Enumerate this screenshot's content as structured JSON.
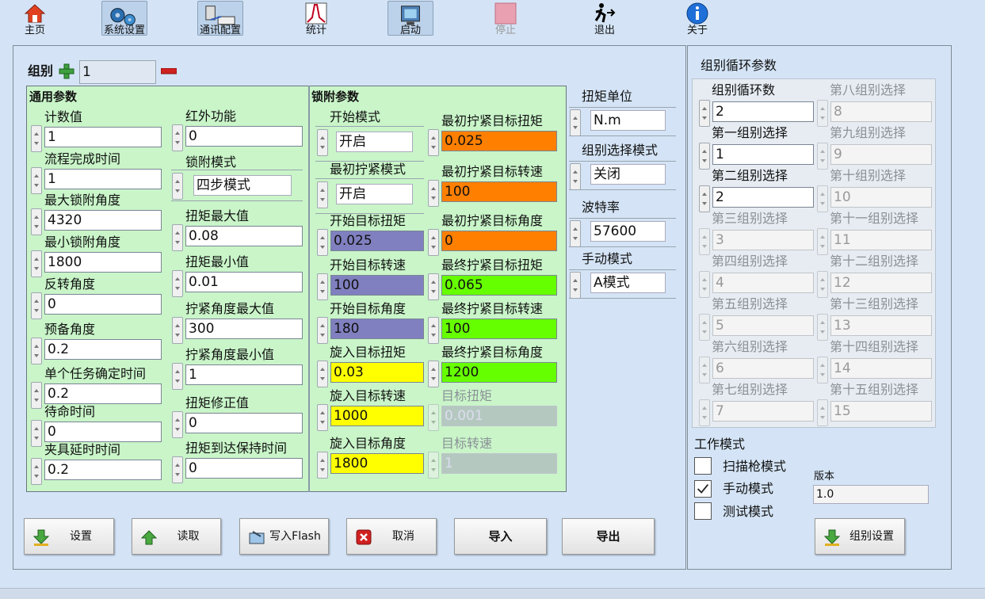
{
  "toolbar": {
    "home": "主页",
    "system_settings": "系统设置",
    "comm_config": "通讯配置",
    "stats": "统计",
    "start": "启动",
    "stop": "停止",
    "exit": "退出",
    "about": "关于"
  },
  "group": {
    "label": "组别",
    "value": "1"
  },
  "general": {
    "title": "通用参数",
    "fields": [
      {
        "label": "计数值",
        "value": "1"
      },
      {
        "label": "流程完成时间",
        "value": "1"
      },
      {
        "label": "最大锁附角度",
        "value": "4320"
      },
      {
        "label": "最小锁附角度",
        "value": "1800"
      },
      {
        "label": "反转角度",
        "value": "0"
      },
      {
        "label": "预备角度",
        "value": "0.2"
      },
      {
        "label": "单个任务确定时间",
        "value": "0.2"
      },
      {
        "label": "待命时间",
        "value": "0"
      },
      {
        "label": "夹具延时时间",
        "value": "0.2"
      }
    ],
    "fields2": [
      {
        "label": "红外功能",
        "value": "0"
      },
      {
        "label": "锁附模式",
        "value": "四步模式"
      },
      {
        "label": "扭矩最大值",
        "value": "0.08"
      },
      {
        "label": "扭矩最小值",
        "value": "0.01"
      },
      {
        "label": "拧紧角度最大值",
        "value": "300"
      },
      {
        "label": "拧紧角度最小值",
        "value": "1"
      },
      {
        "label": "扭矩修正值",
        "value": "0"
      },
      {
        "label": "扭矩到达保持时间",
        "value": "0"
      }
    ]
  },
  "lock": {
    "title": "锁附参数",
    "col1": [
      {
        "label": "开始模式",
        "value": "开启"
      },
      {
        "label": "最初拧紧模式",
        "value": "开启"
      },
      {
        "label": "开始目标扭矩",
        "value": "0.025"
      },
      {
        "label": "开始目标转速",
        "value": "100"
      },
      {
        "label": "开始目标角度",
        "value": "180"
      },
      {
        "label": "旋入目标扭矩",
        "value": "0.03"
      },
      {
        "label": "旋入目标转速",
        "value": "1000"
      },
      {
        "label": "旋入目标角度",
        "value": "1800"
      }
    ],
    "col2": [
      {
        "label": "最初拧紧目标扭矩",
        "value": "0.025"
      },
      {
        "label": "最初拧紧目标转速",
        "value": "100"
      },
      {
        "label": "最初拧紧目标角度",
        "value": "0"
      },
      {
        "label": "最终拧紧目标扭矩",
        "value": "0.065"
      },
      {
        "label": "最终拧紧目标转速",
        "value": "100"
      },
      {
        "label": "最终拧紧目标角度",
        "value": "1200"
      },
      {
        "label": "目标扭矩",
        "value": "0.001"
      },
      {
        "label": "目标转速",
        "value": "1"
      }
    ]
  },
  "side": [
    {
      "label": "扭矩单位",
      "value": "N.m"
    },
    {
      "label": "组别选择模式",
      "value": "关闭"
    },
    {
      "label": "波特率",
      "value": "57600"
    },
    {
      "label": "手动模式",
      "value": "A模式"
    }
  ],
  "cycle": {
    "title": "组别循环参数",
    "left": [
      {
        "label": "组别循环数",
        "value": "2"
      },
      {
        "label": "第一组别选择",
        "value": "1"
      },
      {
        "label": "第二组别选择",
        "value": "2"
      },
      {
        "label": "第三组别选择",
        "value": "3"
      },
      {
        "label": "第四组别选择",
        "value": "4"
      },
      {
        "label": "第五组别选择",
        "value": "5"
      },
      {
        "label": "第六组别选择",
        "value": "6"
      },
      {
        "label": "第七组别选择",
        "value": "7"
      }
    ],
    "right": [
      {
        "label": "第八组别选择",
        "value": "8"
      },
      {
        "label": "第九组别选择",
        "value": "9"
      },
      {
        "label": "第十组别选择",
        "value": "10"
      },
      {
        "label": "第十一组别选择",
        "value": "11"
      },
      {
        "label": "第十二组别选择",
        "value": "12"
      },
      {
        "label": "第十三组别选择",
        "value": "13"
      },
      {
        "label": "第十四组别选择",
        "value": "14"
      },
      {
        "label": "第十五组别选择",
        "value": "15"
      }
    ]
  },
  "work_mode": {
    "title": "工作模式",
    "scan": "扫描枪模式",
    "manual": "手动模式",
    "test": "测试模式",
    "manual_checked": true
  },
  "version": {
    "label": "版本",
    "value": "1.0"
  },
  "buttons": {
    "set": "设置",
    "read": "读取",
    "flash": "写入Flash",
    "cancel": "取消",
    "import": "导入",
    "export": "导出",
    "group_set": "组别设置"
  },
  "colors": {
    "orange": "#ff7f00",
    "purple": "#8080c0",
    "green": "#66ff00",
    "yellow": "#ffff00",
    "panel_green": "#c9f5c9"
  }
}
